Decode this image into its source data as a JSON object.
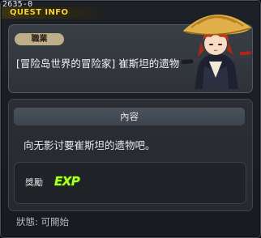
{
  "window": {
    "quest_id": "2635-0",
    "title": "QUEST INFO"
  },
  "quest": {
    "job_label": "職業",
    "name": "[冒险岛世界的冒险家] 崔斯坦的遗物"
  },
  "content": {
    "header": "內容",
    "description": "向无影讨要崔斯坦的遗物吧。"
  },
  "reward": {
    "label": "獎勵",
    "exp_label": "EXP"
  },
  "status": {
    "text": "狀態:  可開始"
  },
  "colors": {
    "title": "#ffd23a",
    "exp": "#b6ff2a"
  }
}
